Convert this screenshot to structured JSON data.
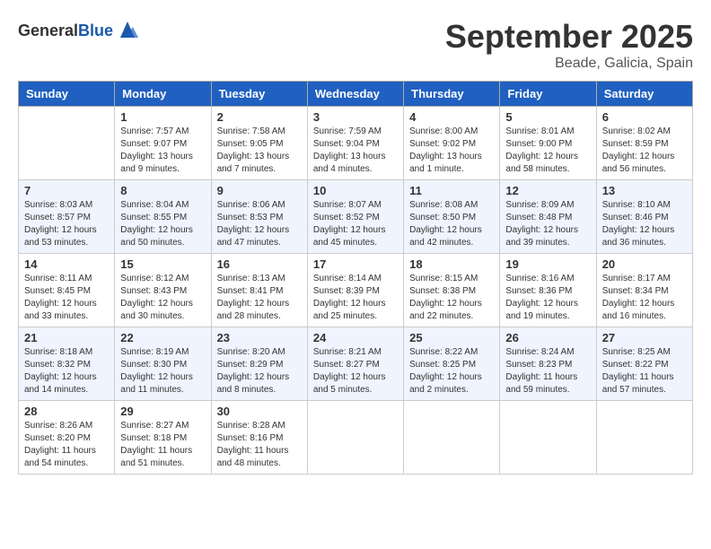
{
  "header": {
    "logo_general": "General",
    "logo_blue": "Blue",
    "month": "September 2025",
    "location": "Beade, Galicia, Spain"
  },
  "weekdays": [
    "Sunday",
    "Monday",
    "Tuesday",
    "Wednesday",
    "Thursday",
    "Friday",
    "Saturday"
  ],
  "weeks": [
    [
      {
        "day": "",
        "info": ""
      },
      {
        "day": "1",
        "info": "Sunrise: 7:57 AM\nSunset: 9:07 PM\nDaylight: 13 hours\nand 9 minutes."
      },
      {
        "day": "2",
        "info": "Sunrise: 7:58 AM\nSunset: 9:05 PM\nDaylight: 13 hours\nand 7 minutes."
      },
      {
        "day": "3",
        "info": "Sunrise: 7:59 AM\nSunset: 9:04 PM\nDaylight: 13 hours\nand 4 minutes."
      },
      {
        "day": "4",
        "info": "Sunrise: 8:00 AM\nSunset: 9:02 PM\nDaylight: 13 hours\nand 1 minute."
      },
      {
        "day": "5",
        "info": "Sunrise: 8:01 AM\nSunset: 9:00 PM\nDaylight: 12 hours\nand 58 minutes."
      },
      {
        "day": "6",
        "info": "Sunrise: 8:02 AM\nSunset: 8:59 PM\nDaylight: 12 hours\nand 56 minutes."
      }
    ],
    [
      {
        "day": "7",
        "info": "Sunrise: 8:03 AM\nSunset: 8:57 PM\nDaylight: 12 hours\nand 53 minutes."
      },
      {
        "day": "8",
        "info": "Sunrise: 8:04 AM\nSunset: 8:55 PM\nDaylight: 12 hours\nand 50 minutes."
      },
      {
        "day": "9",
        "info": "Sunrise: 8:06 AM\nSunset: 8:53 PM\nDaylight: 12 hours\nand 47 minutes."
      },
      {
        "day": "10",
        "info": "Sunrise: 8:07 AM\nSunset: 8:52 PM\nDaylight: 12 hours\nand 45 minutes."
      },
      {
        "day": "11",
        "info": "Sunrise: 8:08 AM\nSunset: 8:50 PM\nDaylight: 12 hours\nand 42 minutes."
      },
      {
        "day": "12",
        "info": "Sunrise: 8:09 AM\nSunset: 8:48 PM\nDaylight: 12 hours\nand 39 minutes."
      },
      {
        "day": "13",
        "info": "Sunrise: 8:10 AM\nSunset: 8:46 PM\nDaylight: 12 hours\nand 36 minutes."
      }
    ],
    [
      {
        "day": "14",
        "info": "Sunrise: 8:11 AM\nSunset: 8:45 PM\nDaylight: 12 hours\nand 33 minutes."
      },
      {
        "day": "15",
        "info": "Sunrise: 8:12 AM\nSunset: 8:43 PM\nDaylight: 12 hours\nand 30 minutes."
      },
      {
        "day": "16",
        "info": "Sunrise: 8:13 AM\nSunset: 8:41 PM\nDaylight: 12 hours\nand 28 minutes."
      },
      {
        "day": "17",
        "info": "Sunrise: 8:14 AM\nSunset: 8:39 PM\nDaylight: 12 hours\nand 25 minutes."
      },
      {
        "day": "18",
        "info": "Sunrise: 8:15 AM\nSunset: 8:38 PM\nDaylight: 12 hours\nand 22 minutes."
      },
      {
        "day": "19",
        "info": "Sunrise: 8:16 AM\nSunset: 8:36 PM\nDaylight: 12 hours\nand 19 minutes."
      },
      {
        "day": "20",
        "info": "Sunrise: 8:17 AM\nSunset: 8:34 PM\nDaylight: 12 hours\nand 16 minutes."
      }
    ],
    [
      {
        "day": "21",
        "info": "Sunrise: 8:18 AM\nSunset: 8:32 PM\nDaylight: 12 hours\nand 14 minutes."
      },
      {
        "day": "22",
        "info": "Sunrise: 8:19 AM\nSunset: 8:30 PM\nDaylight: 12 hours\nand 11 minutes."
      },
      {
        "day": "23",
        "info": "Sunrise: 8:20 AM\nSunset: 8:29 PM\nDaylight: 12 hours\nand 8 minutes."
      },
      {
        "day": "24",
        "info": "Sunrise: 8:21 AM\nSunset: 8:27 PM\nDaylight: 12 hours\nand 5 minutes."
      },
      {
        "day": "25",
        "info": "Sunrise: 8:22 AM\nSunset: 8:25 PM\nDaylight: 12 hours\nand 2 minutes."
      },
      {
        "day": "26",
        "info": "Sunrise: 8:24 AM\nSunset: 8:23 PM\nDaylight: 11 hours\nand 59 minutes."
      },
      {
        "day": "27",
        "info": "Sunrise: 8:25 AM\nSunset: 8:22 PM\nDaylight: 11 hours\nand 57 minutes."
      }
    ],
    [
      {
        "day": "28",
        "info": "Sunrise: 8:26 AM\nSunset: 8:20 PM\nDaylight: 11 hours\nand 54 minutes."
      },
      {
        "day": "29",
        "info": "Sunrise: 8:27 AM\nSunset: 8:18 PM\nDaylight: 11 hours\nand 51 minutes."
      },
      {
        "day": "30",
        "info": "Sunrise: 8:28 AM\nSunset: 8:16 PM\nDaylight: 11 hours\nand 48 minutes."
      },
      {
        "day": "",
        "info": ""
      },
      {
        "day": "",
        "info": ""
      },
      {
        "day": "",
        "info": ""
      },
      {
        "day": "",
        "info": ""
      }
    ]
  ]
}
